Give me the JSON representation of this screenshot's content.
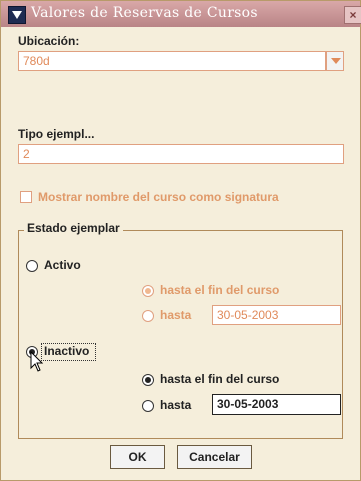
{
  "window": {
    "title": "Valores de Reservas de Cursos",
    "close": "×"
  },
  "ubicacion": {
    "label": "Ubicación:",
    "value": "780d"
  },
  "tipo": {
    "label": "Tipo ejempl...",
    "value": "2"
  },
  "mostrar": {
    "label": "Mostrar nombre del curso como signatura",
    "checked": false
  },
  "estado": {
    "legend": "Estado ejemplar",
    "activo": {
      "label": "Activo",
      "selected": false,
      "opt_fin": "hasta el fin del curso",
      "opt_hasta": "hasta",
      "date": "30-05-2003"
    },
    "inactivo": {
      "label": "Inactivo",
      "selected": true,
      "opt_fin": "hasta el fin del curso",
      "opt_hasta": "hasta",
      "date": "30-05-2003"
    }
  },
  "buttons": {
    "ok": "OK",
    "cancel": "Cancelar"
  },
  "colors": {
    "title_bar": "#c08f90",
    "background": "#f5eedb",
    "disabled_text": "#e09a6a"
  }
}
